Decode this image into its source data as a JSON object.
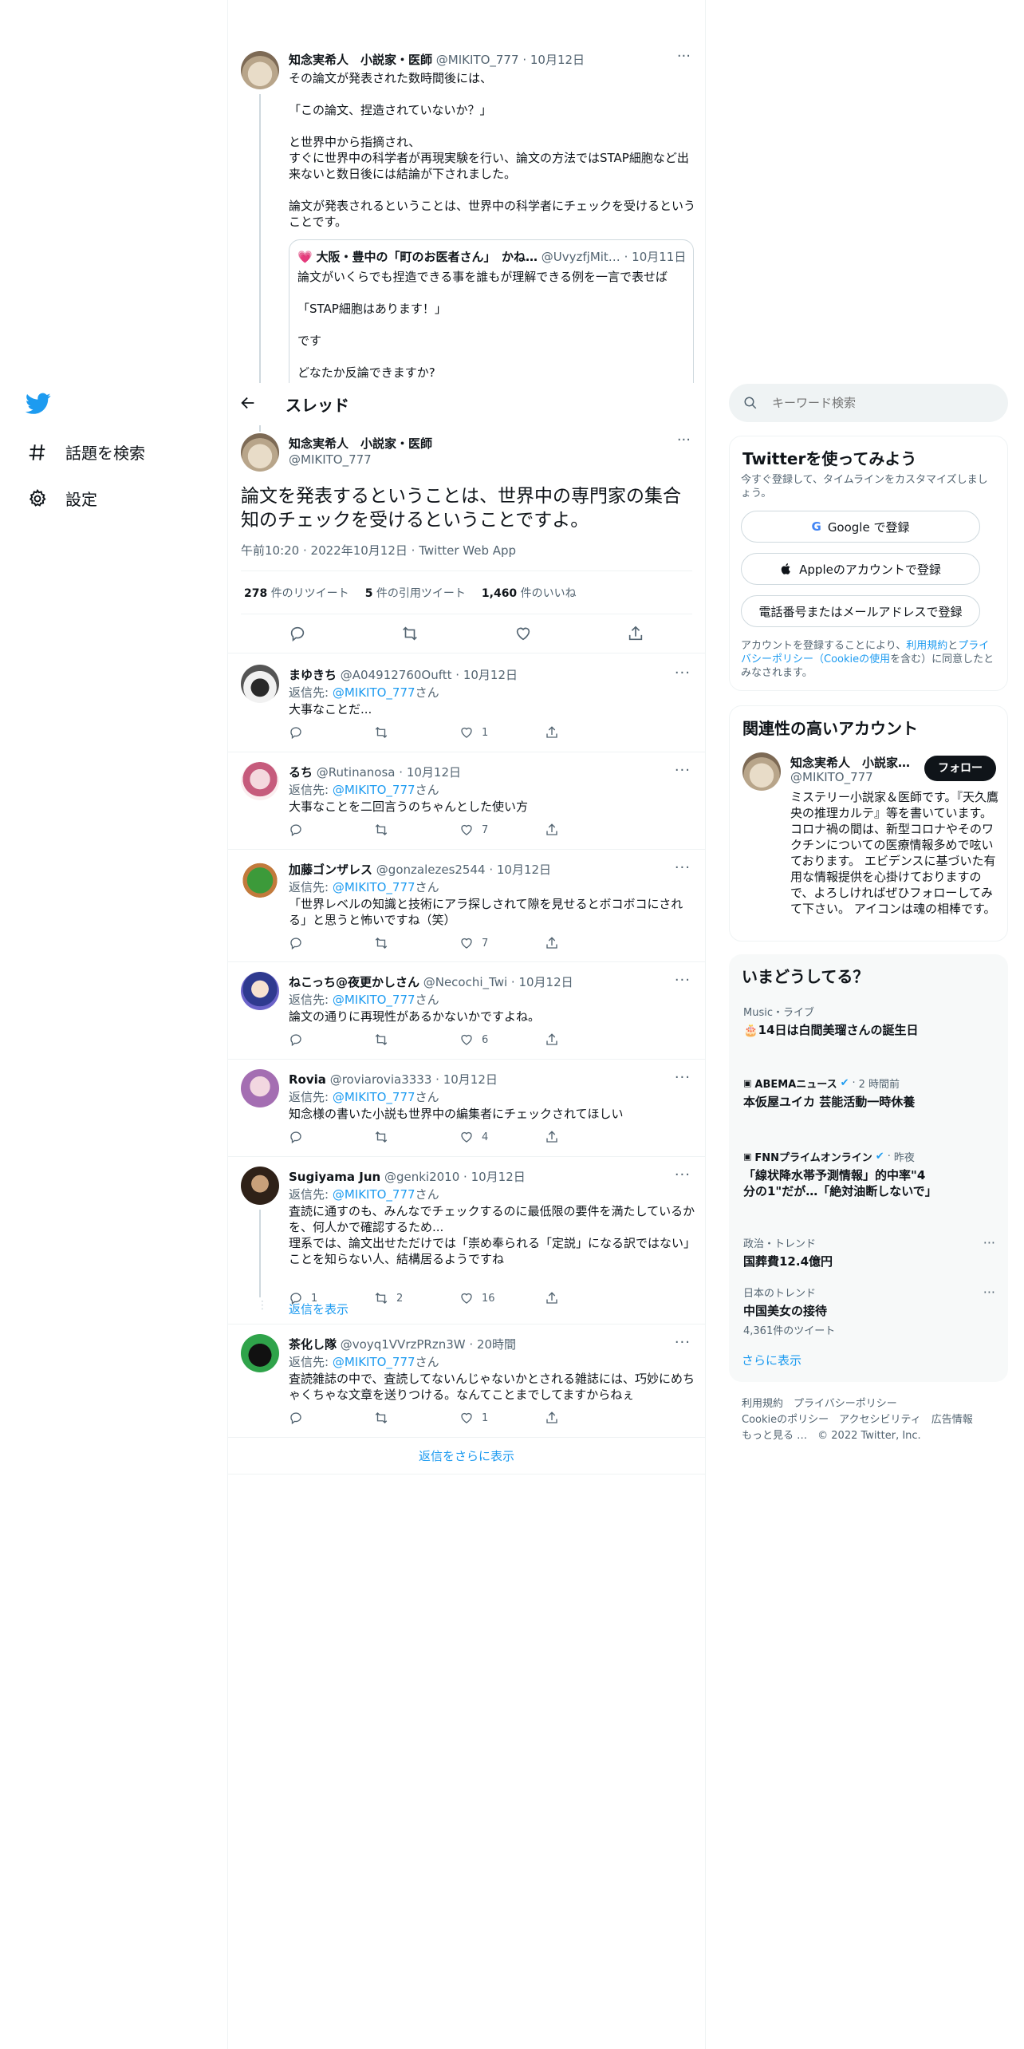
{
  "nav": {
    "explore_label": "話題を検索",
    "settings_label": "設定"
  },
  "header": {
    "title": "スレッド"
  },
  "parent": {
    "name": "知念実希人　小説家・医師",
    "handle": "@MIKITO_777",
    "date": "10月12日",
    "lines": [
      "その論文が発表された数時間後には、",
      "",
      "「この論文、捏造されていないか？」",
      "",
      "と世界中から指摘され、",
      "すぐに世界中の科学者が再現実験を行い、論文の方法ではSTAP細胞など出来ないと数日後には結論が下されました。",
      "",
      "論文が発表されるということは、世界中の科学者にチェックを受けるということです。"
    ],
    "quote": {
      "name": "大阪・豊中の「町のお医者さん」　かね…",
      "handle": "@UvyzfjMit…",
      "date": "10月11日",
      "lines": [
        "論文がいくらでも捏造できる事を誰もが理解できる例を一言で表せば",
        "",
        "「STAP細胞はあります！」",
        "",
        "です",
        "",
        "どなたか反論できますか?"
      ]
    }
  },
  "main": {
    "name": "知念実希人　小説家・医師",
    "handle": "@MIKITO_777",
    "text": "論文を発表するということは、世界中の専門家の集合知のチェックを受けるということですよ。",
    "time": "午前10:20",
    "date": "2022年10月12日",
    "client": "Twitter Web App",
    "retweets_count": "278",
    "retweets_label": "件のリツイート",
    "quotes_count": "5",
    "quotes_label": "件の引用ツイート",
    "likes_count": "1,460",
    "likes_label": "件のいいね"
  },
  "reply_prefix": "返信先: ",
  "reply_suffix": "さん",
  "reply_to": "@MIKITO_777",
  "replies": [
    {
      "name": "まゆきち",
      "handle": "@A04912760Ouftt",
      "date": "10月12日",
      "text": "大事なことだ...",
      "replies": "",
      "retweets": "",
      "likes": "1"
    },
    {
      "name": "るち",
      "handle": "@Rutinanosa",
      "date": "10月12日",
      "text": "大事なことを二回言うのちゃんとした使い方",
      "replies": "",
      "retweets": "",
      "likes": "7"
    },
    {
      "name": "加藤ゴンザレス",
      "handle": "@gonzalezes2544",
      "date": "10月12日",
      "text": "「世界レベルの知識と技術にアラ探しされて隙を見せるとボコボコにされる」と思うと怖いですね（笑）",
      "replies": "",
      "retweets": "",
      "likes": "7"
    },
    {
      "name": "ねこっち@夜更かしさん",
      "handle": "@Necochi_Twi",
      "date": "10月12日",
      "text": "論文の通りに再現性があるかないかですよね。",
      "replies": "",
      "retweets": "",
      "likes": "6"
    },
    {
      "name": "Rovia",
      "handle": "@roviarovia3333",
      "date": "10月12日",
      "text": "知念様の書いた小説も世界中の編集者にチェックされてほしい",
      "replies": "",
      "retweets": "",
      "likes": "4"
    },
    {
      "name": "Sugiyama Jun",
      "handle": "@genki2010",
      "date": "10月12日",
      "text": "査読に通すのも、みんなでチェックするのに最低限の要件を満たしているかを、何人かで確認するため...\n理系では、論文出せただけでは「崇め奉られる「定説」になる訳ではない」ことを知らない人、結構居るようですね",
      "replies": "1",
      "retweets": "2",
      "likes": "16"
    },
    {
      "name": "茶化し隊",
      "handle": "@voyq1VVrzPRzn3W",
      "date": "20時間",
      "text": "査読雑誌の中で、査読してないんじゃないかとされる雑誌には、巧妙にめちゃくちゃな文章を送りつける。なんてことまでしてますからねぇ",
      "replies": "",
      "retweets": "",
      "likes": "1"
    }
  ],
  "show_replies": "返信を表示",
  "show_more_replies": "返信をさらに表示",
  "search": {
    "placeholder": "キーワード検索"
  },
  "signup": {
    "title": "Twitterを使ってみよう",
    "subtitle": "今すぐ登録して、タイムラインをカスタマイズしましょう。",
    "google": "Google で登録",
    "apple": "Appleのアカウントで登録",
    "phone": "電話番号またはメールアドレスで登録",
    "legal_1": "アカウントを登録することにより、",
    "legal_terms": "利用規約",
    "legal_2": "と",
    "legal_privacy": "プライバシーポリシー（Cookieの使用",
    "legal_3": "を含む）に同意したとみなされます。"
  },
  "relevant": {
    "title": "関連性の高いアカウント",
    "name": "知念実希人　小説家…",
    "handle": "@MIKITO_777",
    "follow": "フォロー",
    "bio": "ミステリー小説家＆医師です。『天久鷹央の推理カルテ』等を書いています。 コロナ禍の間は、新型コロナやそのワクチンについての医療情報多めで呟いております。 エビデンスに基づいた有用な情報提供を心掛けておりますので、よろしければぜひフォローしてみて下さい。 アイコンは魂の相棒です。"
  },
  "trends": {
    "title": "いまどうしてる？",
    "items": [
      {
        "category": "Music・ライブ",
        "title": "🎂14日は白間美瑠さんの誕生日"
      },
      {
        "source": "ABEMAニュース",
        "time": "2 時間前",
        "title": "本仮屋ユイカ 芸能活動一時休養"
      },
      {
        "source": "FNNプライムオンライン",
        "time": "昨夜",
        "title": "「線状降水帯予測情報」的中率\"4分の1\"だが…「絶対油断しないで」"
      },
      {
        "category": "政治・トレンド",
        "title": "国葬費12.4億円"
      },
      {
        "category": "日本のトレンド",
        "title": "中国美女の接待",
        "count": "4,361件のツイート"
      }
    ],
    "show_more": "さらに表示"
  },
  "footer": {
    "terms": "利用規約",
    "privacy": "プライバシーポリシー",
    "cookie": "Cookieのポリシー",
    "accessibility": "アクセシビリティ",
    "ads": "広告情報",
    "more": "もっと見る …",
    "copyright": "© 2022 Twitter, Inc."
  },
  "colors": {
    "accent": "#1d9bf0",
    "text": "#0f1419",
    "muted": "#536471",
    "border": "#eff3f4"
  }
}
